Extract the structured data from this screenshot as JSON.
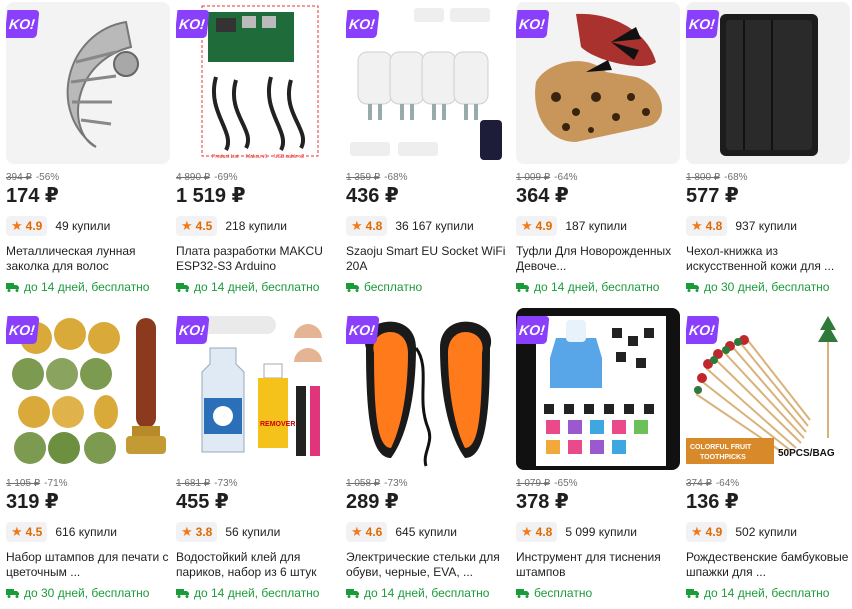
{
  "badge": "KO!",
  "colors": {
    "accent": "#8a3ffc",
    "rating": "#f27a1a",
    "delivery": "#1a9b3a"
  },
  "icons": {
    "badge": "ko-badge",
    "star": "star-icon",
    "delivery": "truck-icon"
  },
  "products": [
    {
      "old_price": "394 ₽",
      "discount": "-56%",
      "price": "174 ₽",
      "rating": "4.9",
      "bought": "49 купили",
      "title": "Металлическая лунная заколка для волос",
      "delivery": "до 14 дней, бесплатно"
    },
    {
      "old_price": "4 890 ₽",
      "discount": "-69%",
      "price": "1 519 ₽",
      "rating": "4.5",
      "bought": "218 купили",
      "title": "Плата разработки MAKCU ESP32-S3 Arduino",
      "delivery": "до 14 дней, бесплатно",
      "image_text": {
        "list": "Product List",
        "board": "Makcu v1",
        "cable": "USB cable x2"
      }
    },
    {
      "old_price": "1 359 ₽",
      "discount": "-68%",
      "price": "436 ₽",
      "rating": "4.8",
      "bought": "36 167 купили",
      "title": "Szaoju Smart EU Socket WiFi 20A",
      "delivery": "бесплатно"
    },
    {
      "old_price": "1 009 ₽",
      "discount": "-64%",
      "price": "364 ₽",
      "rating": "4.9",
      "bought": "187 купили",
      "title": "Туфли Для Новорожденных Девоче...",
      "delivery": "до 14 дней, бесплатно"
    },
    {
      "old_price": "1 800 ₽",
      "discount": "-68%",
      "price": "577 ₽",
      "rating": "4.8",
      "bought": "937 купили",
      "title": "Чехол-книжка из искусственной кожи для ...",
      "delivery": "до 30 дней, бесплатно"
    },
    {
      "old_price": "1 105 ₽",
      "discount": "-71%",
      "price": "319 ₽",
      "rating": "4.5",
      "bought": "616 купили",
      "title": "Набор штампов для печати с цветочным ...",
      "delivery": "до 30 дней, бесплатно"
    },
    {
      "old_price": "1 681 ₽",
      "discount": "-73%",
      "price": "455 ₽",
      "rating": "3.8",
      "bought": "56 купили",
      "title": "Водостойкий клей для париков, набор из 6 штук",
      "delivery": "до 14 дней, бесплатно",
      "image_text": {
        "remover": "REMOVER"
      }
    },
    {
      "old_price": "1 058 ₽",
      "discount": "-73%",
      "price": "289 ₽",
      "rating": "4.6",
      "bought": "645 купили",
      "title": "Электрические стельки для обуви, черные, EVA, ...",
      "delivery": "до 14 дней, бесплатно"
    },
    {
      "old_price": "1 079 ₽",
      "discount": "-65%",
      "price": "378 ₽",
      "rating": "4.8",
      "bought": "5 099 купили",
      "title": "Инструмент для тиснения штампов",
      "delivery": "бесплатно"
    },
    {
      "old_price": "374 ₽",
      "discount": "-64%",
      "price": "136 ₽",
      "rating": "4.9",
      "bought": "502 купили",
      "title": "Рождественские бамбуковые шпажки для ...",
      "delivery": "до 14 дней, бесплатно",
      "image_text": {
        "banner1": "COLORFUL FRUIT",
        "banner2": "TOOTHPICKS",
        "pack": "50PCS/BAG"
      }
    }
  ]
}
